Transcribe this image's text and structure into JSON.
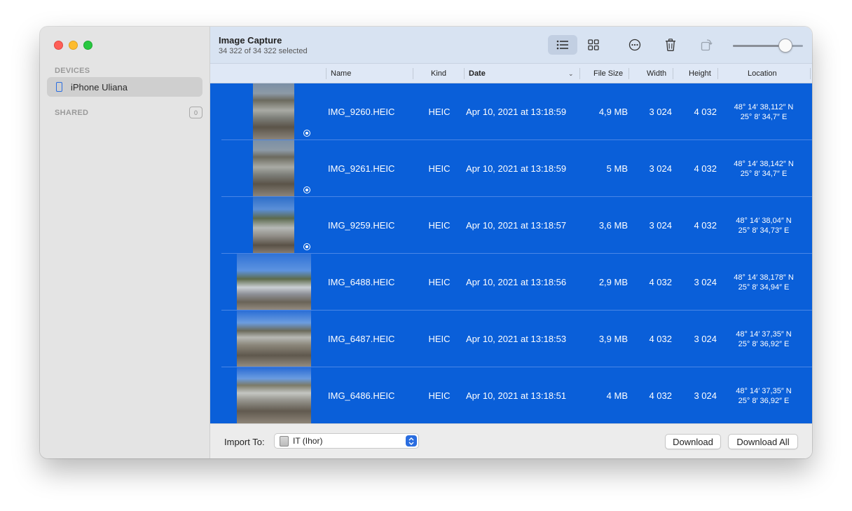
{
  "window": {
    "traffic_lights": [
      "close",
      "minimize",
      "zoom"
    ]
  },
  "sidebar": {
    "devices_heading": "DEVICES",
    "device_name": "iPhone Uliana",
    "shared_heading": "SHARED",
    "shared_count": "0"
  },
  "toolbar": {
    "title": "Image Capture",
    "subtitle": "34 322 of 34 322 selected",
    "icons": [
      "list-view-icon",
      "grid-view-icon",
      "more-options-icon",
      "trash-icon",
      "rotate-icon"
    ],
    "thumbnail_size_level": 0.75
  },
  "table": {
    "columns": [
      "Name",
      "Kind",
      "Date",
      "File Size",
      "Width",
      "Height",
      "Location"
    ],
    "sorted_column": "Date",
    "rows": [
      {
        "name": "IMG_9260.HEIC",
        "kind": "HEIC",
        "date": "Apr 10, 2021 at 13:18:59",
        "size": "4,9 MB",
        "width": "3 024",
        "height": "4 032",
        "lat": "48° 14′ 38,112″ N",
        "lon": "25° 8′ 34,7″ E"
      },
      {
        "name": "IMG_9261.HEIC",
        "kind": "HEIC",
        "date": "Apr 10, 2021 at 13:18:59",
        "size": "5 MB",
        "width": "3 024",
        "height": "4 032",
        "lat": "48° 14′ 38,142″ N",
        "lon": "25° 8′ 34,7″ E"
      },
      {
        "name": "IMG_9259.HEIC",
        "kind": "HEIC",
        "date": "Apr 10, 2021 at 13:18:57",
        "size": "3,6 MB",
        "width": "3 024",
        "height": "4 032",
        "lat": "48° 14′ 38,04″ N",
        "lon": "25° 8′ 34,73″ E"
      },
      {
        "name": "IMG_6488.HEIC",
        "kind": "HEIC",
        "date": "Apr 10, 2021 at 13:18:56",
        "size": "2,9 MB",
        "width": "4 032",
        "height": "3 024",
        "lat": "48° 14′ 38,178″ N",
        "lon": "25° 8′ 34,94″ E"
      },
      {
        "name": "IMG_6487.HEIC",
        "kind": "HEIC",
        "date": "Apr 10, 2021 at 13:18:53",
        "size": "3,9 MB",
        "width": "4 032",
        "height": "3 024",
        "lat": "48° 14′ 37,35″ N",
        "lon": "25° 8′ 36,92″ E"
      },
      {
        "name": "IMG_6486.HEIC",
        "kind": "HEIC",
        "date": "Apr 10, 2021 at 13:18:51",
        "size": "4 MB",
        "width": "4 032",
        "height": "3 024",
        "lat": "48° 14′ 37,35″ N",
        "lon": "25° 8′ 36,92″ E"
      }
    ]
  },
  "bottom": {
    "import_label": "Import To:",
    "import_value": "IT (Ihor)",
    "download_label": "Download",
    "download_all_label": "Download All"
  },
  "colors": {
    "selection": "#0a5fd9",
    "toolbar": "#d8e3f2",
    "accent": "#2a6de0"
  }
}
